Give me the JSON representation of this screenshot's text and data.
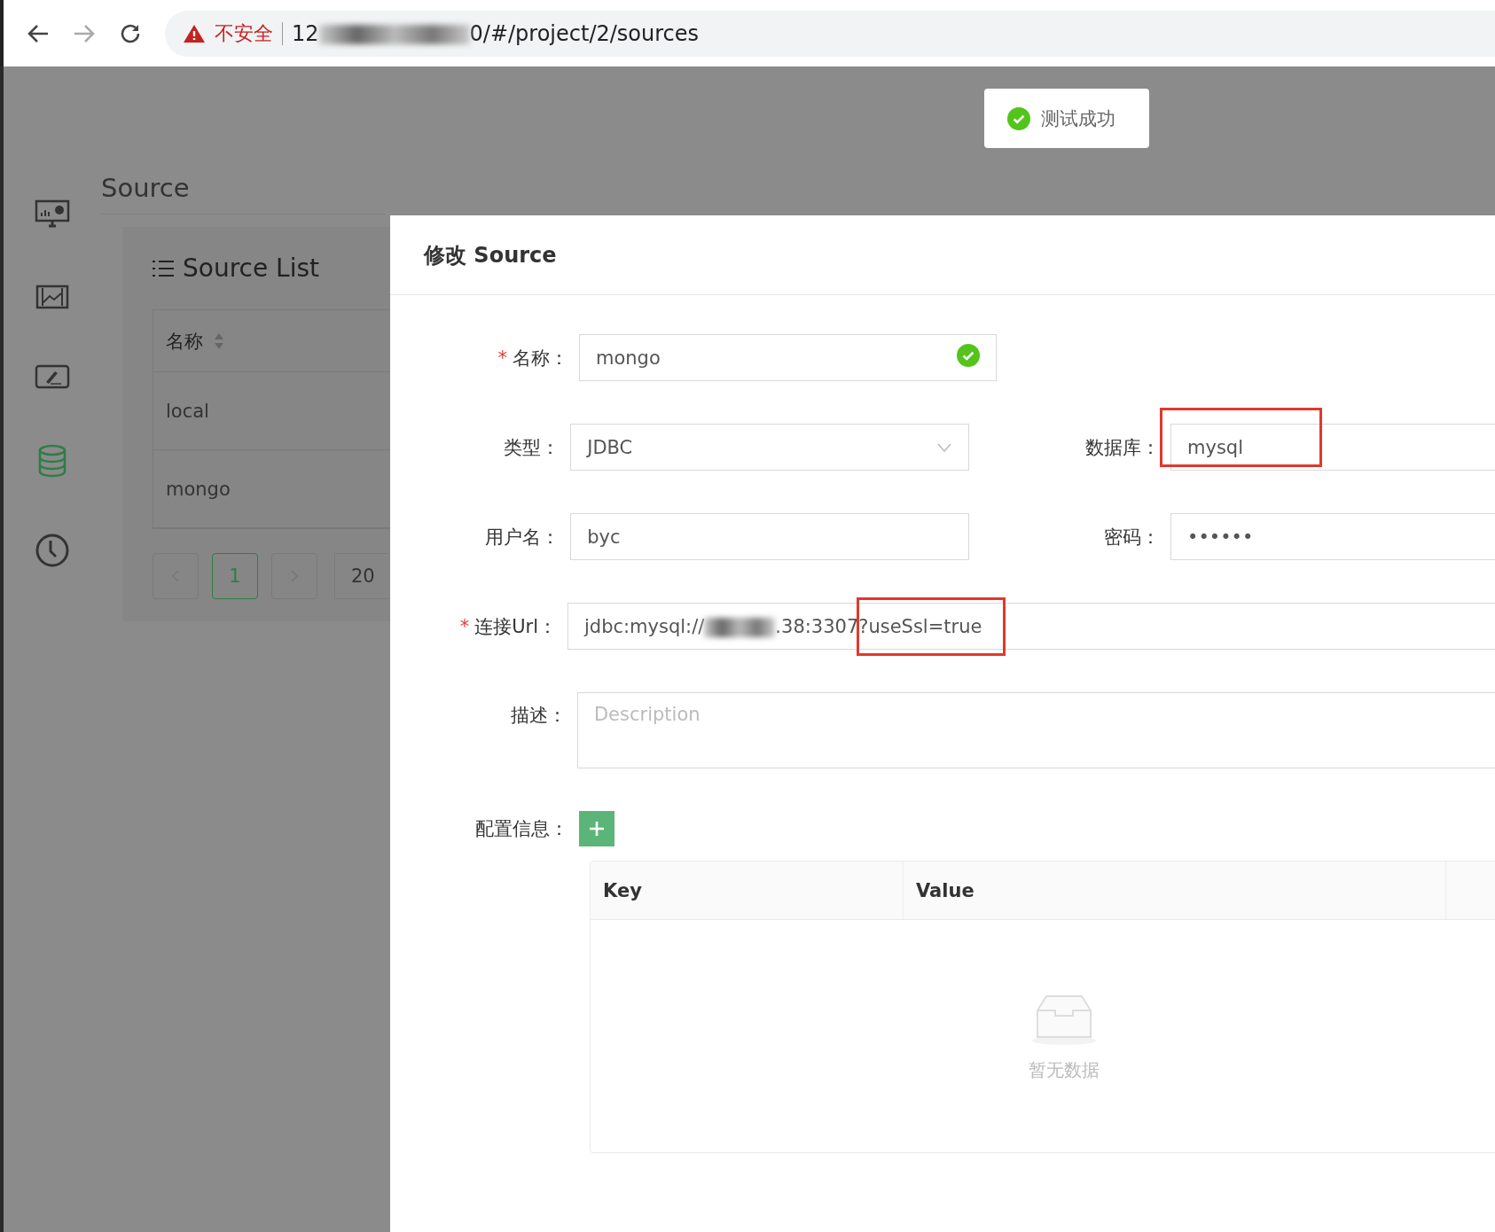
{
  "browser": {
    "warning": "不安全",
    "url_start": "12",
    "url_end": "0/#/project/2/sources"
  },
  "toast": {
    "text": "测试成功"
  },
  "sidebar": {
    "items": [
      {
        "selected": false
      },
      {
        "selected": false
      },
      {
        "selected": false
      },
      {
        "selected": true
      },
      {
        "selected": false
      }
    ]
  },
  "page": {
    "title": "Source"
  },
  "source_list": {
    "title": "Source List",
    "column": "名称",
    "rows": [
      "local",
      "mongo"
    ],
    "pagination": {
      "pages": [
        {
          "label": "1",
          "selected": true
        }
      ],
      "page_size": "20"
    }
  },
  "dialog": {
    "title": "修改 Source",
    "fields": [
      {
        "kind": "input",
        "required_mark": "*",
        "label": "名称：",
        "value": "mongo",
        "valid": true
      },
      {
        "kind": "select",
        "label": "类型：",
        "value": "JDBC",
        "side": {
          "label": "数据库：",
          "value": "mysql",
          "highlighted": true
        }
      },
      {
        "kind": "input",
        "label": "用户名：",
        "value": "byc",
        "side": {
          "label": "密码：",
          "value": "••••••"
        }
      },
      {
        "kind": "url",
        "required_mark": "*",
        "label": "连接Url：",
        "value_start": "jdbc:mysql://",
        "value_mid": ".38:3307",
        "value_end": "?useSsl=true",
        "highlighted": true
      },
      {
        "kind": "textarea",
        "label": "描述：",
        "placeholder": "Description"
      }
    ],
    "config": {
      "label": "配置信息：",
      "columns": [
        "Key",
        "Value"
      ],
      "empty": "暂无数据"
    }
  }
}
